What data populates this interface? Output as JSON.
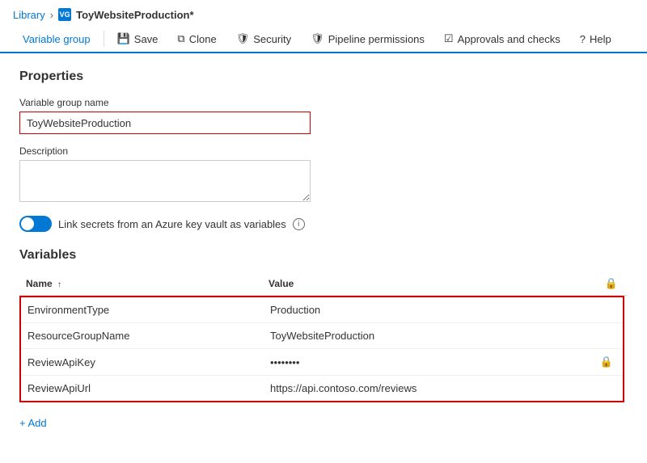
{
  "breadcrumb": {
    "library": "Library",
    "separator": "›",
    "current_page": "ToyWebsiteProduction*",
    "icon_label": "VG"
  },
  "toolbar": {
    "tabs": [
      {
        "id": "variable-group",
        "label": "Variable group",
        "active": true,
        "icon": null
      },
      {
        "id": "save",
        "label": "Save",
        "icon": "💾"
      },
      {
        "id": "clone",
        "label": "Clone",
        "icon": "⧉"
      },
      {
        "id": "security",
        "label": "Security",
        "icon": "🛡"
      },
      {
        "id": "pipeline-permissions",
        "label": "Pipeline permissions",
        "icon": "🛡"
      },
      {
        "id": "approvals-checks",
        "label": "Approvals and checks",
        "icon": "☑"
      },
      {
        "id": "help",
        "label": "Help",
        "icon": "?"
      }
    ]
  },
  "properties": {
    "section_title": "Properties",
    "variable_group_name_label": "Variable group name",
    "variable_group_name_value": "ToyWebsiteProduction",
    "variable_group_name_placeholder": "",
    "description_label": "Description",
    "description_value": "",
    "description_placeholder": "",
    "toggle_label": "Link secrets from an Azure key vault as variables"
  },
  "variables": {
    "section_title": "Variables",
    "columns": {
      "name": "Name",
      "value": "Value",
      "lock": "🔒"
    },
    "rows": [
      {
        "name": "EnvironmentType",
        "value": "Production",
        "locked": false
      },
      {
        "name": "ResourceGroupName",
        "value": "ToyWebsiteProduction",
        "locked": false
      },
      {
        "name": "ReviewApiKey",
        "value": "••••••••",
        "locked": true
      },
      {
        "name": "ReviewApiUrl",
        "value": "https://api.contoso.com/reviews",
        "locked": false
      }
    ]
  },
  "add_button": {
    "label": "+ Add"
  }
}
